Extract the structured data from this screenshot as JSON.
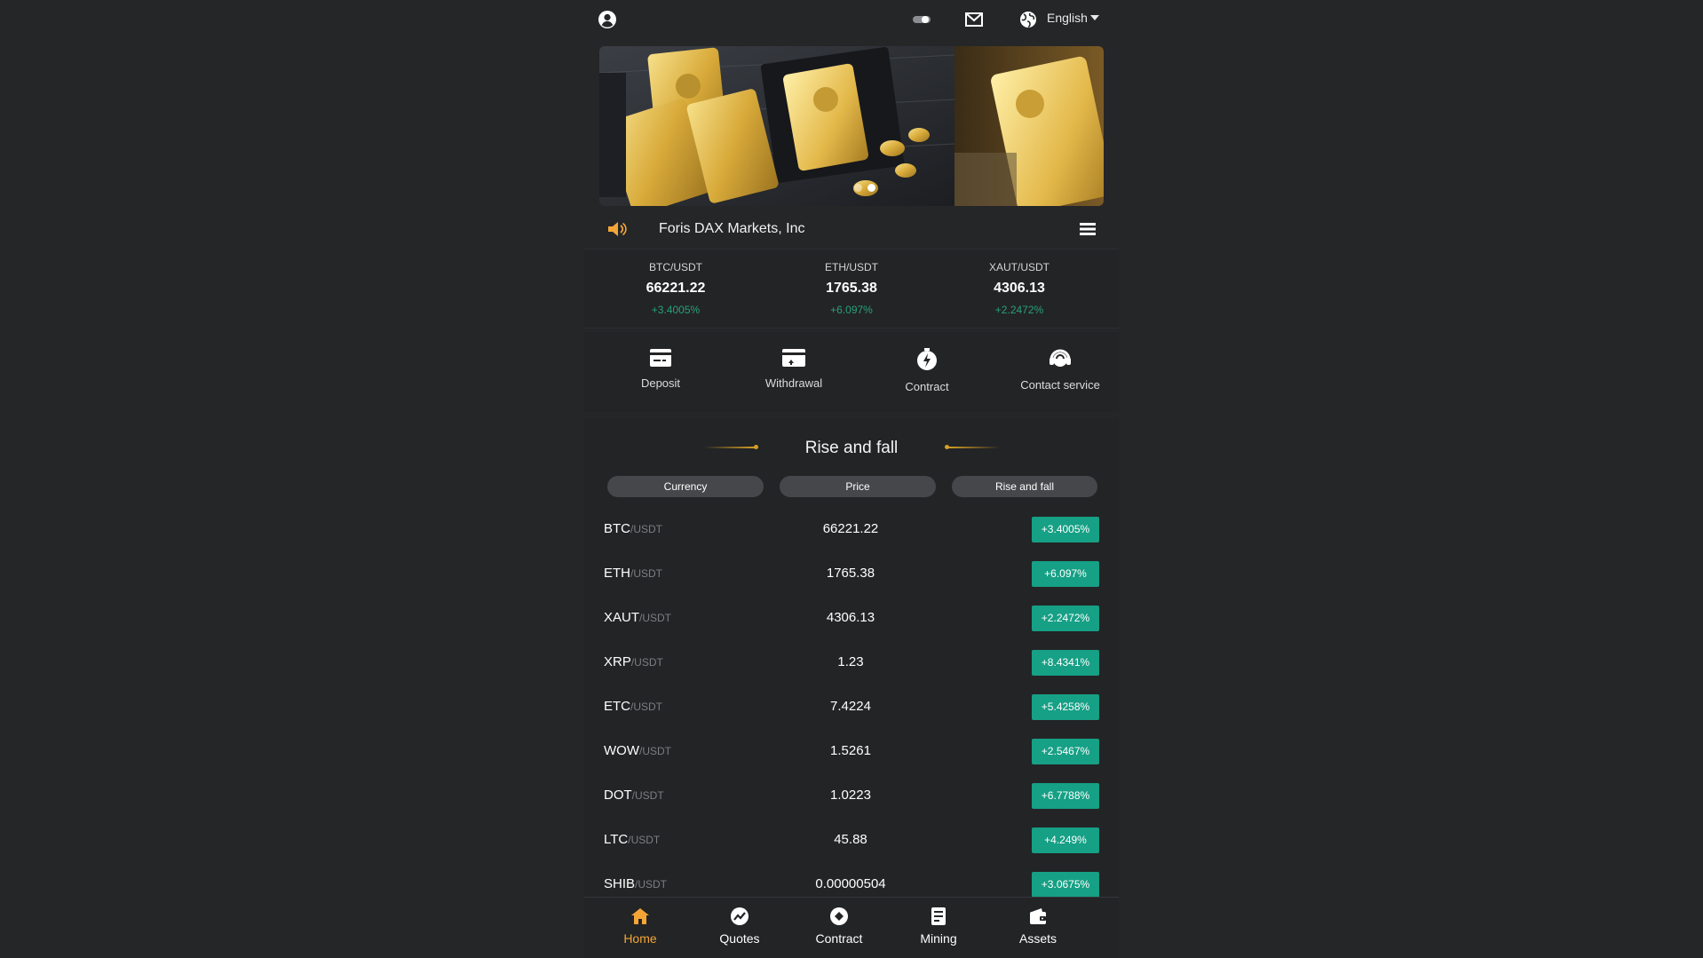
{
  "topbar": {
    "language": "English"
  },
  "notice": {
    "text": "Foris DAX Markets, Inc"
  },
  "ticker": [
    {
      "pair": "BTC/USDT",
      "price": "66221.22",
      "change": "+3.4005%"
    },
    {
      "pair": "ETH/USDT",
      "price": "1765.38",
      "change": "+6.097%"
    },
    {
      "pair": "XAUT/USDT",
      "price": "4306.13",
      "change": "+2.2472%"
    }
  ],
  "actions": [
    {
      "label": "Deposit",
      "icon": "deposit-icon"
    },
    {
      "label": "Withdrawal",
      "icon": "withdrawal-icon"
    },
    {
      "label": "Contract",
      "icon": "contract-icon"
    },
    {
      "label": "Contact service",
      "icon": "headset-icon"
    }
  ],
  "market": {
    "title": "Rise and fall",
    "headers": [
      "Currency",
      "Price",
      "Rise and fall"
    ],
    "rows": [
      {
        "base": "BTC",
        "quote": "/USDT",
        "price": "66221.22",
        "change": "+3.4005%"
      },
      {
        "base": "ETH",
        "quote": "/USDT",
        "price": "1765.38",
        "change": "+6.097%"
      },
      {
        "base": "XAUT",
        "quote": "/USDT",
        "price": "4306.13",
        "change": "+2.2472%"
      },
      {
        "base": "XRP",
        "quote": "/USDT",
        "price": "1.23",
        "change": "+8.4341%"
      },
      {
        "base": "ETC",
        "quote": "/USDT",
        "price": "7.4224",
        "change": "+5.4258%"
      },
      {
        "base": "WOW",
        "quote": "/USDT",
        "price": "1.5261",
        "change": "+2.5467%"
      },
      {
        "base": "DOT",
        "quote": "/USDT",
        "price": "1.0223",
        "change": "+6.7788%"
      },
      {
        "base": "LTC",
        "quote": "/USDT",
        "price": "45.88",
        "change": "+4.249%"
      },
      {
        "base": "SHIB",
        "quote": "/USDT",
        "price": "0.00000504",
        "change": "+3.0675%"
      }
    ]
  },
  "bottom_nav": [
    {
      "label": "Home",
      "icon": "home-icon",
      "active": true
    },
    {
      "label": "Quotes",
      "icon": "quotes-icon",
      "active": false
    },
    {
      "label": "Contract",
      "icon": "contract-icon",
      "active": false
    },
    {
      "label": "Mining",
      "icon": "mining-icon",
      "active": false
    },
    {
      "label": "Assets",
      "icon": "wallet-icon",
      "active": false
    }
  ],
  "colors": {
    "background": "#252628",
    "panel": "#232426",
    "rise": "#16a085",
    "rise_text": "#27a17a",
    "accent": "#f3a637",
    "gold": "#d4a023"
  },
  "banner": {
    "slides": 2,
    "active_slide": 2
  }
}
